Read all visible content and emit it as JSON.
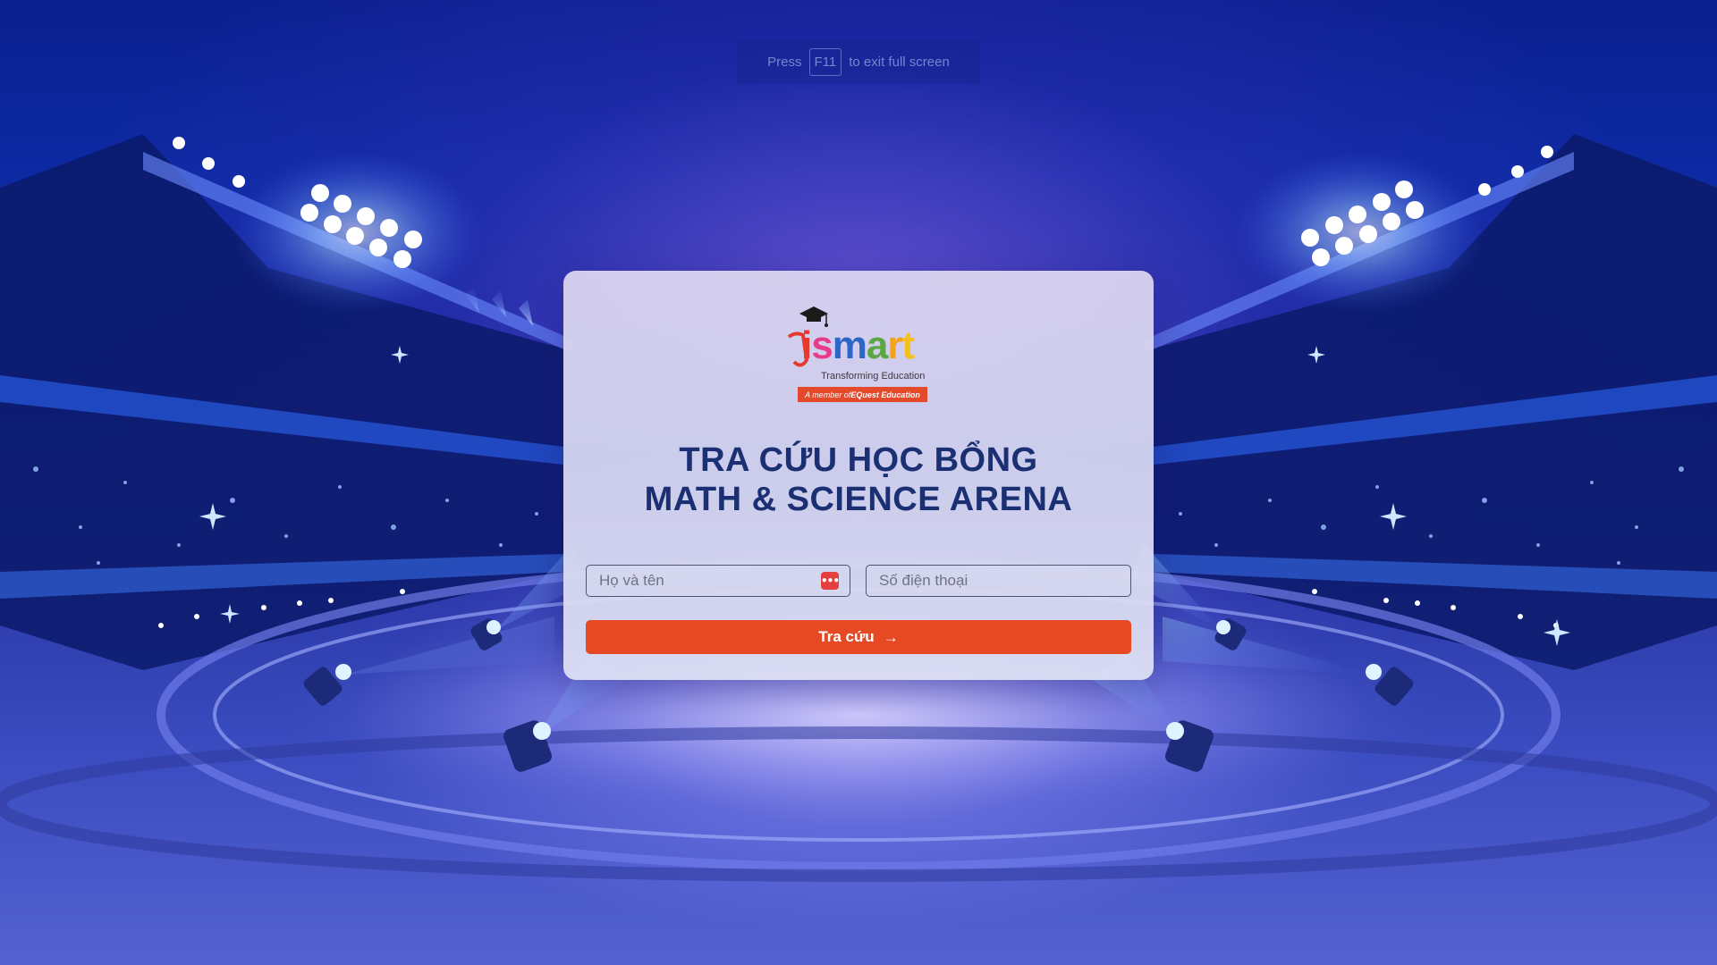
{
  "fullscreen_notice": {
    "prefix": "Press",
    "key": "F11",
    "suffix": "to exit full screen"
  },
  "logo": {
    "word_letters": [
      {
        "char": "i",
        "color": "#e63a30"
      },
      {
        "char": "s",
        "color": "#e73a8a"
      },
      {
        "char": "m",
        "color": "#2d66c9"
      },
      {
        "char": "a",
        "color": "#5aa83f"
      },
      {
        "char": "r",
        "color": "#f3a21a"
      },
      {
        "char": "t",
        "color": "#f3c11a"
      }
    ],
    "tagline": "Transforming Education",
    "member_prefix": "A member of ",
    "member_org": "EQuest Education"
  },
  "title": {
    "line1": "TRA CỨU HỌC BỔNG",
    "line2": "MATH & SCIENCE ARENA"
  },
  "form": {
    "name_placeholder": "Họ và tên",
    "phone_placeholder": "Số điện thoại",
    "password_manager_icon": "•••",
    "submit_label": "Tra cứu",
    "submit_icon": "→"
  },
  "colors": {
    "title": "#1b2f73",
    "button": "#e64a24",
    "accent_red": "#e5403d"
  }
}
